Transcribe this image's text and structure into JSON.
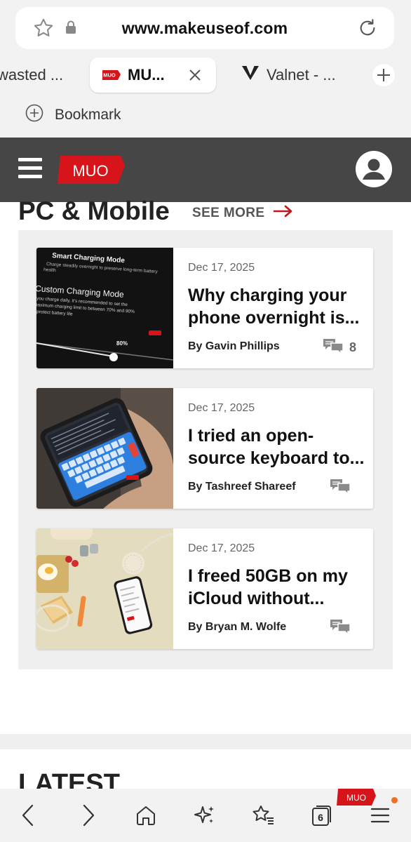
{
  "browser": {
    "url": "www.makeuseof.com",
    "tabs": [
      {
        "label": "wasted ..."
      },
      {
        "label": "MU..."
      },
      {
        "label": "Valnet - ..."
      }
    ],
    "bookmark_label": "Bookmark",
    "tab_count": "6"
  },
  "site": {
    "logo_text": "MUO",
    "section_title": "PC & Mobile",
    "see_more": "SEE MORE",
    "latest_title": "LATEST"
  },
  "articles": [
    {
      "date": "Dec 17, 2025",
      "title": "Why charging your phone overnight is...",
      "author": "By Gavin Phillips",
      "comments": "8",
      "thumb_text": {
        "line1": "Smart Charging Mode",
        "line2": "Charge steadily overnight to preserve long-term battery",
        "line3": "health",
        "line4": "Custom Charging Mode",
        "line5": "you charge daily, it's recommended to set the",
        "line6": "maximum charging limit to between 70% and 90%",
        "line7": "protect battery life",
        "pct": "80%"
      }
    },
    {
      "date": "Dec 17, 2025",
      "title": "I tried an open-source keyboard to...",
      "author": "By Tashreef Shareef",
      "comments": ""
    },
    {
      "date": "Dec 17, 2025",
      "title": "I freed 50GB on my iCloud without...",
      "author": "By Bryan M. Wolfe",
      "comments": ""
    }
  ],
  "colors": {
    "brand_red": "#d7141a",
    "header_bg": "#464646",
    "chrome_bg": "#f2f2f2",
    "panel_bg": "#f0f0f0"
  }
}
